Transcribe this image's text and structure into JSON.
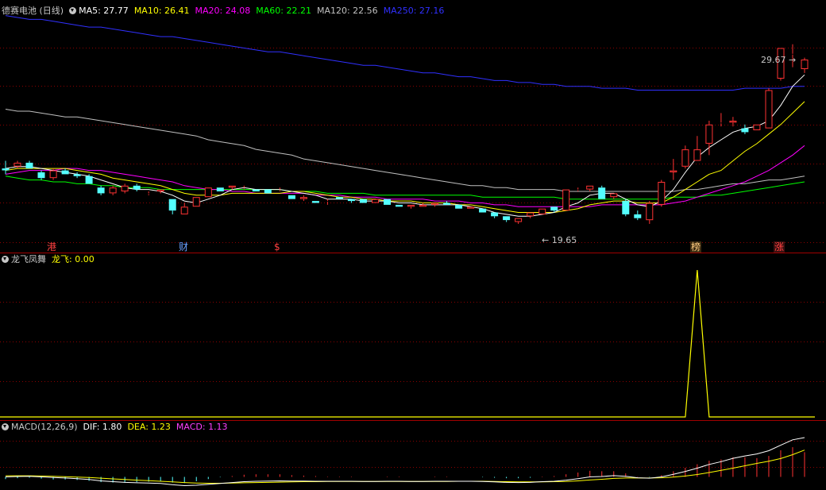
{
  "colors": {
    "up": "#ff3232",
    "down": "#54ffff",
    "grid": "#8b0000",
    "ma5": "#ffffff",
    "ma10": "#ffff00",
    "ma20": "#ff00ff",
    "ma60": "#00ff00",
    "ma120": "#c0c0c0",
    "ma250": "#3030ff"
  },
  "header": {
    "stock": "德赛电池 (日线)",
    "ma": [
      {
        "label": "MA5: 27.77",
        "color": "#ffffff"
      },
      {
        "label": "MA10: 26.41",
        "color": "#ffff00"
      },
      {
        "label": "MA20: 24.08",
        "color": "#ff00ff"
      },
      {
        "label": "MA60: 22.21",
        "color": "#00ff00"
      },
      {
        "label": "MA120: 22.56",
        "color": "#c0c0c0"
      },
      {
        "label": "MA250: 27.16",
        "color": "#3030ff"
      }
    ]
  },
  "indicator": {
    "name": "龙飞凤舞",
    "value_label": "龙飞: 0.00"
  },
  "macd": {
    "name": "MACD(12,26,9)",
    "dif": "DIF: 1.80",
    "dea": "DEA: 1.23",
    "macd": "MACD: 1.13"
  },
  "annotations": {
    "high": "29.67",
    "low": "19.65"
  },
  "markers": [
    {
      "label": "港",
      "color": "#ff4040"
    },
    {
      "label": "财",
      "color": "#6aa0ff"
    },
    {
      "label": "$",
      "color": "#ff4040"
    },
    {
      "label": "榜",
      "color": "#ffcc80"
    },
    {
      "label": "涨",
      "color": "#ff4040"
    }
  ],
  "chart_data": {
    "type": "candlestick",
    "price_range": [
      19.0,
      31.3
    ],
    "candles": [
      [
        22.9,
        23.3,
        22.6,
        22.8
      ],
      [
        23.0,
        23.3,
        22.9,
        23.2
      ],
      [
        23.2,
        23.3,
        22.9,
        22.9
      ],
      [
        22.7,
        22.8,
        22.3,
        22.4
      ],
      [
        22.4,
        22.9,
        22.3,
        22.8
      ],
      [
        22.8,
        22.9,
        22.6,
        22.6
      ],
      [
        22.6,
        22.7,
        22.4,
        22.5
      ],
      [
        22.5,
        22.6,
        22.1,
        22.1
      ],
      [
        21.9,
        22.0,
        21.5,
        21.6
      ],
      [
        21.6,
        22.0,
        21.5,
        21.9
      ],
      [
        21.7,
        22.1,
        21.6,
        22.0
      ],
      [
        22.0,
        22.1,
        21.7,
        21.8
      ],
      [
        21.6,
        21.7,
        21.5,
        21.6
      ],
      [
        21.7,
        21.8,
        21.6,
        21.8
      ],
      [
        21.3,
        21.3,
        20.5,
        20.7
      ],
      [
        20.5,
        21.1,
        20.5,
        20.9
      ],
      [
        20.9,
        21.4,
        20.9,
        21.4
      ],
      [
        21.4,
        21.9,
        21.4,
        21.9
      ],
      [
        21.9,
        21.9,
        21.7,
        21.7
      ],
      [
        21.9,
        22.0,
        21.8,
        22.0
      ],
      [
        21.9,
        22.0,
        21.8,
        21.9
      ],
      [
        21.8,
        21.8,
        21.7,
        21.7
      ],
      [
        21.8,
        21.8,
        21.6,
        21.6
      ],
      [
        21.8,
        21.9,
        21.7,
        21.8
      ],
      [
        21.5,
        21.5,
        21.3,
        21.3
      ],
      [
        21.3,
        21.5,
        21.2,
        21.4
      ],
      [
        21.2,
        21.2,
        21.1,
        21.1
      ],
      [
        21.2,
        21.3,
        21.0,
        21.2
      ],
      [
        21.4,
        21.4,
        21.3,
        21.3
      ],
      [
        21.3,
        21.3,
        21.1,
        21.2
      ],
      [
        21.3,
        21.3,
        21.1,
        21.1
      ],
      [
        21.1,
        21.3,
        21.1,
        21.3
      ],
      [
        21.3,
        21.3,
        21.0,
        21.0
      ],
      [
        21.0,
        21.0,
        20.9,
        20.9
      ],
      [
        20.9,
        21.0,
        20.8,
        21.0
      ],
      [
        20.9,
        21.1,
        20.9,
        21.0
      ],
      [
        21.0,
        21.1,
        20.9,
        21.1
      ],
      [
        21.1,
        21.2,
        21.0,
        21.0
      ],
      [
        21.0,
        21.0,
        20.8,
        20.8
      ],
      [
        20.8,
        20.9,
        20.8,
        20.9
      ],
      [
        20.8,
        20.8,
        20.6,
        20.6
      ],
      [
        20.6,
        20.6,
        20.3,
        20.4
      ],
      [
        20.4,
        20.4,
        20.1,
        20.2
      ],
      [
        20.1,
        20.3,
        20.0,
        20.3
      ],
      [
        20.4,
        20.6,
        20.3,
        20.6
      ],
      [
        20.5,
        20.8,
        20.5,
        20.8
      ],
      [
        20.9,
        20.9,
        20.6,
        20.7
      ],
      [
        20.7,
        21.8,
        20.7,
        21.8
      ],
      [
        21.8,
        21.9,
        21.7,
        21.8
      ],
      [
        21.8,
        22.0,
        21.7,
        22.0
      ],
      [
        21.9,
        22.0,
        21.3,
        21.3
      ],
      [
        21.4,
        21.6,
        21.3,
        21.6
      ],
      [
        21.2,
        21.3,
        20.4,
        20.5
      ],
      [
        20.5,
        20.7,
        20.2,
        20.3
      ],
      [
        20.2,
        21.2,
        20.0,
        21.1
      ],
      [
        21.0,
        22.3,
        20.9,
        22.2
      ],
      [
        22.7,
        23.4,
        22.3,
        22.8
      ],
      [
        23.0,
        24.1,
        22.9,
        23.9
      ],
      [
        23.3,
        24.6,
        23.3,
        23.9
      ],
      [
        24.2,
        25.4,
        23.6,
        25.2
      ],
      [
        25.3,
        25.8,
        25.1,
        25.3
      ],
      [
        25.3,
        25.6,
        25.1,
        25.4
      ],
      [
        25.0,
        25.2,
        24.7,
        24.8
      ],
      [
        24.9,
        25.2,
        24.9,
        25.2
      ],
      [
        25.0,
        27.1,
        25.0,
        27.0
      ],
      [
        27.6,
        29.2,
        27.5,
        29.2
      ],
      [
        28.9,
        29.4,
        28.2,
        28.9
      ],
      [
        28.1,
        28.7,
        27.9,
        28.6
      ]
    ],
    "ma": {
      "ma5": [
        22.9,
        23.0,
        23.0,
        22.9,
        22.8,
        22.7,
        22.6,
        22.5,
        22.3,
        22.1,
        21.9,
        21.8,
        21.8,
        21.7,
        21.5,
        21.2,
        21.1,
        21.3,
        21.5,
        21.8,
        21.9,
        21.8,
        21.8,
        21.8,
        21.7,
        21.6,
        21.5,
        21.3,
        21.3,
        21.3,
        21.2,
        21.2,
        21.2,
        21.1,
        21.1,
        21.0,
        21.0,
        21.0,
        21.0,
        20.9,
        20.8,
        20.6,
        20.5,
        20.4,
        20.4,
        20.5,
        20.6,
        20.9,
        21.1,
        21.5,
        21.6,
        21.6,
        21.3,
        21.0,
        20.9,
        21.2,
        21.8,
        22.7,
        23.5,
        24.0,
        24.4,
        24.8,
        25.0,
        25.1,
        25.4,
        26.2,
        27.2,
        27.8
      ],
      "ma10": [
        22.8,
        22.9,
        22.9,
        22.9,
        22.9,
        22.9,
        22.8,
        22.7,
        22.6,
        22.4,
        22.3,
        22.2,
        22.1,
        22.0,
        21.8,
        21.6,
        21.5,
        21.5,
        21.5,
        21.6,
        21.6,
        21.6,
        21.6,
        21.6,
        21.7,
        21.7,
        21.6,
        21.5,
        21.4,
        21.4,
        21.3,
        21.3,
        21.2,
        21.2,
        21.2,
        21.1,
        21.1,
        21.1,
        21.0,
        21.0,
        20.9,
        20.8,
        20.7,
        20.6,
        20.6,
        20.6,
        20.6,
        20.7,
        20.8,
        21.0,
        21.1,
        21.2,
        21.2,
        21.1,
        21.1,
        21.1,
        21.4,
        21.8,
        22.2,
        22.6,
        22.8,
        23.3,
        23.8,
        24.2,
        24.7,
        25.2,
        25.8,
        26.4
      ],
      "ma20": [
        22.6,
        22.7,
        22.8,
        22.8,
        22.8,
        22.9,
        22.9,
        22.8,
        22.8,
        22.7,
        22.6,
        22.5,
        22.4,
        22.3,
        22.2,
        22.0,
        21.9,
        21.8,
        21.8,
        21.7,
        21.7,
        21.6,
        21.6,
        21.6,
        21.6,
        21.6,
        21.5,
        21.5,
        21.5,
        21.4,
        21.4,
        21.4,
        21.3,
        21.3,
        21.3,
        21.3,
        21.2,
        21.2,
        21.2,
        21.1,
        21.1,
        21.0,
        21.0,
        20.9,
        20.9,
        20.9,
        20.9,
        20.9,
        20.9,
        20.9,
        21.0,
        21.0,
        21.0,
        21.0,
        21.0,
        21.0,
        21.1,
        21.2,
        21.4,
        21.6,
        21.8,
        22.0,
        22.2,
        22.5,
        22.8,
        23.2,
        23.6,
        24.1
      ],
      "ma60": [
        22.5,
        22.4,
        22.3,
        22.3,
        22.2,
        22.2,
        22.1,
        22.1,
        22.0,
        22.0,
        21.9,
        21.9,
        21.9,
        21.8,
        21.8,
        21.8,
        21.8,
        21.8,
        21.8,
        21.8,
        21.8,
        21.8,
        21.8,
        21.8,
        21.7,
        21.7,
        21.7,
        21.6,
        21.6,
        21.6,
        21.6,
        21.5,
        21.5,
        21.5,
        21.5,
        21.5,
        21.5,
        21.5,
        21.5,
        21.5,
        21.4,
        21.4,
        21.4,
        21.4,
        21.4,
        21.4,
        21.4,
        21.3,
        21.3,
        21.3,
        21.3,
        21.3,
        21.3,
        21.3,
        21.3,
        21.3,
        21.4,
        21.4,
        21.4,
        21.5,
        21.5,
        21.6,
        21.7,
        21.8,
        21.9,
        22.0,
        22.1,
        22.2
      ],
      "ma120": [
        26.0,
        25.9,
        25.9,
        25.8,
        25.7,
        25.6,
        25.6,
        25.5,
        25.4,
        25.3,
        25.2,
        25.1,
        25.0,
        24.9,
        24.8,
        24.7,
        24.6,
        24.4,
        24.3,
        24.2,
        24.1,
        23.9,
        23.8,
        23.7,
        23.6,
        23.4,
        23.3,
        23.2,
        23.1,
        23.0,
        22.9,
        22.8,
        22.7,
        22.6,
        22.5,
        22.4,
        22.3,
        22.2,
        22.1,
        22.0,
        22.0,
        21.9,
        21.9,
        21.8,
        21.8,
        21.8,
        21.8,
        21.7,
        21.7,
        21.7,
        21.7,
        21.7,
        21.7,
        21.7,
        21.7,
        21.7,
        21.7,
        21.8,
        21.8,
        21.9,
        22.0,
        22.1,
        22.1,
        22.2,
        22.3,
        22.3,
        22.4,
        22.5
      ],
      "ma250": [
        30.9,
        30.8,
        30.7,
        30.7,
        30.6,
        30.5,
        30.4,
        30.3,
        30.3,
        30.2,
        30.1,
        30.0,
        29.9,
        29.8,
        29.8,
        29.7,
        29.6,
        29.5,
        29.4,
        29.3,
        29.2,
        29.1,
        29.0,
        29.0,
        28.9,
        28.8,
        28.7,
        28.6,
        28.5,
        28.4,
        28.3,
        28.3,
        28.2,
        28.1,
        28.0,
        27.9,
        27.9,
        27.8,
        27.7,
        27.7,
        27.6,
        27.5,
        27.5,
        27.4,
        27.4,
        27.3,
        27.3,
        27.2,
        27.2,
        27.2,
        27.1,
        27.1,
        27.1,
        27.0,
        27.0,
        27.0,
        27.0,
        27.0,
        27.0,
        27.0,
        27.0,
        27.0,
        27.1,
        27.1,
        27.1,
        27.1,
        27.2,
        27.2
      ]
    },
    "indicator_values": [
      0,
      0,
      0,
      0,
      0,
      0,
      0,
      0,
      0,
      0,
      0,
      0,
      0,
      0,
      0,
      0,
      0,
      0,
      0,
      0,
      0,
      0,
      0,
      0,
      0,
      0,
      0,
      0,
      0,
      0,
      0,
      0,
      0,
      0,
      0,
      0,
      0,
      0,
      0,
      0,
      0,
      0,
      0,
      0,
      0,
      0,
      0,
      0,
      0,
      0,
      0,
      0,
      0,
      0,
      0,
      0,
      0,
      0,
      1,
      0,
      0,
      0,
      0,
      0,
      0,
      0,
      0,
      0
    ],
    "macd_range": [
      -0.6,
      2.2
    ],
    "dif": [
      0.0,
      0.02,
      0.03,
      0.0,
      -0.03,
      -0.05,
      -0.08,
      -0.12,
      -0.18,
      -0.22,
      -0.25,
      -0.27,
      -0.28,
      -0.3,
      -0.36,
      -0.4,
      -0.38,
      -0.34,
      -0.3,
      -0.26,
      -0.22,
      -0.2,
      -0.19,
      -0.18,
      -0.19,
      -0.19,
      -0.2,
      -0.2,
      -0.2,
      -0.2,
      -0.21,
      -0.21,
      -0.2,
      -0.2,
      -0.21,
      -0.21,
      -0.2,
      -0.2,
      -0.2,
      -0.2,
      -0.21,
      -0.23,
      -0.25,
      -0.26,
      -0.25,
      -0.22,
      -0.2,
      -0.15,
      -0.08,
      0.0,
      0.02,
      0.06,
      0.03,
      -0.04,
      -0.06,
      0.0,
      0.12,
      0.25,
      0.4,
      0.57,
      0.7,
      0.85,
      0.96,
      1.05,
      1.2,
      1.45,
      1.7,
      1.8
    ],
    "dea": [
      0.05,
      0.05,
      0.05,
      0.04,
      0.03,
      0.01,
      -0.01,
      -0.03,
      -0.06,
      -0.09,
      -0.12,
      -0.15,
      -0.17,
      -0.2,
      -0.23,
      -0.26,
      -0.28,
      -0.29,
      -0.29,
      -0.28,
      -0.27,
      -0.26,
      -0.25,
      -0.24,
      -0.23,
      -0.22,
      -0.22,
      -0.21,
      -0.21,
      -0.21,
      -0.21,
      -0.21,
      -0.21,
      -0.21,
      -0.21,
      -0.21,
      -0.21,
      -0.21,
      -0.2,
      -0.2,
      -0.2,
      -0.21,
      -0.22,
      -0.23,
      -0.23,
      -0.23,
      -0.22,
      -0.21,
      -0.18,
      -0.14,
      -0.11,
      -0.07,
      -0.05,
      -0.05,
      -0.05,
      -0.04,
      -0.01,
      0.04,
      0.11,
      0.2,
      0.3,
      0.4,
      0.51,
      0.62,
      0.72,
      0.84,
      1.02,
      1.23
    ],
    "macd": [
      -0.1,
      -0.06,
      -0.04,
      -0.08,
      -0.12,
      -0.12,
      -0.14,
      -0.18,
      -0.24,
      -0.26,
      -0.26,
      -0.24,
      -0.22,
      -0.2,
      -0.26,
      -0.28,
      -0.2,
      -0.1,
      -0.02,
      0.04,
      0.1,
      0.12,
      0.12,
      0.12,
      0.08,
      0.06,
      0.04,
      0.02,
      0.02,
      0.02,
      0.0,
      0.0,
      0.02,
      0.02,
      0.0,
      0.0,
      0.02,
      0.02,
      0.0,
      0.0,
      -0.02,
      -0.04,
      -0.06,
      -0.06,
      -0.04,
      0.02,
      0.04,
      0.12,
      0.2,
      0.28,
      0.26,
      0.26,
      0.16,
      0.02,
      -0.02,
      0.08,
      0.26,
      0.42,
      0.58,
      0.74,
      0.8,
      0.9,
      0.9,
      0.86,
      0.96,
      1.22,
      1.36,
      1.13
    ]
  }
}
